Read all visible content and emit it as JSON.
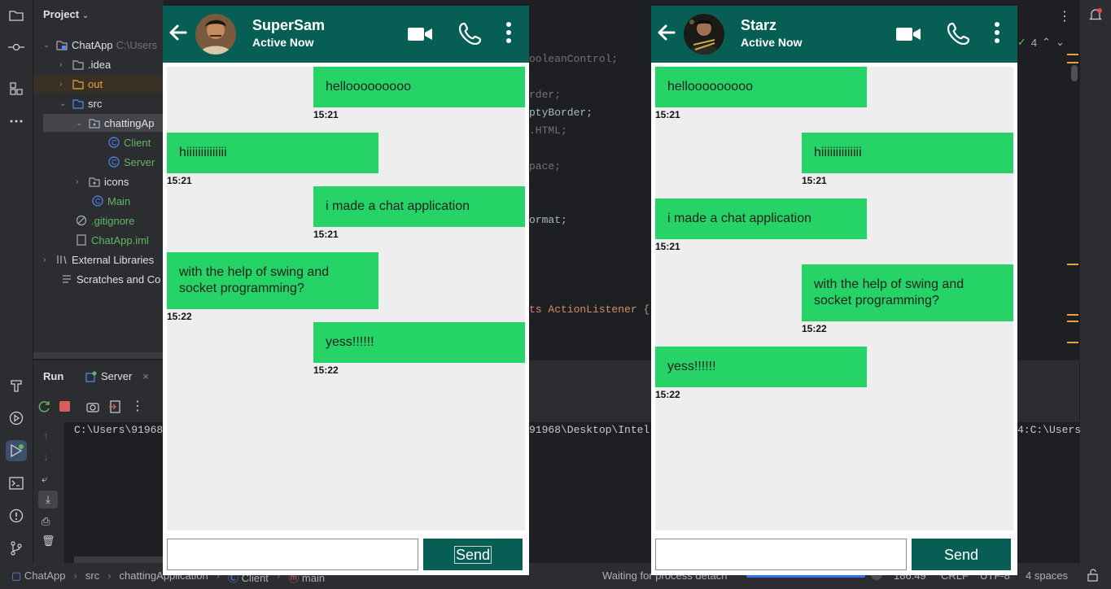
{
  "ide": {
    "project_label": "Project",
    "tree": [
      {
        "label": "ChatApp",
        "suffix": "C:\\Users"
      },
      {
        "label": ".idea"
      },
      {
        "label": "out"
      },
      {
        "label": "src"
      },
      {
        "label": "chattingAp"
      },
      {
        "label": "Client"
      },
      {
        "label": "Server"
      },
      {
        "label": "icons"
      },
      {
        "label": "Main"
      },
      {
        "label": ".gitignore"
      },
      {
        "label": "ChatApp.iml"
      },
      {
        "label": "External Libraries"
      },
      {
        "label": "Scratches and Co"
      }
    ],
    "code_fragments": [
      "ooleanControl;",
      "rder;",
      "ptyBorder;",
      ".HTML;",
      "pace;",
      "ormat;",
      "ts ActionListener {"
    ],
    "problems_count": "4",
    "run": {
      "tab_run": "Run",
      "tab_server": "Server",
      "console_left": "C:\\Users\\91968",
      "console_mid": "91968\\Desktop\\Intel",
      "console_right": "4:C:\\Users"
    },
    "status": {
      "breadcrumb": [
        "ChatApp",
        "src",
        "chattingApplication",
        "Client",
        "main"
      ],
      "process": "Waiting for process detach",
      "position": "186:49",
      "line_sep": "CRLF",
      "encoding": "UTF-8",
      "indent": "4 spaces"
    }
  },
  "chats": [
    {
      "name": "SuperSam",
      "status": "Active Now",
      "messages": [
        {
          "text": "hellooooooooo",
          "time": "15:21",
          "side": "right"
        },
        {
          "text": "hiiiiiiiiiiiiii",
          "time": "15:21",
          "side": "left"
        },
        {
          "text": "i made a chat application",
          "time": "15:21",
          "side": "right"
        },
        {
          "text": "with the help of swing and socket programming?",
          "time": "15:22",
          "side": "left"
        },
        {
          "text": "yess!!!!!!",
          "time": "15:22",
          "side": "right"
        }
      ],
      "input_value": "",
      "send_label": "Send"
    },
    {
      "name": "Starz",
      "status": "Active Now",
      "messages": [
        {
          "text": "hellooooooooo",
          "time": "15:21",
          "side": "left"
        },
        {
          "text": "hiiiiiiiiiiiiii",
          "time": "15:21",
          "side": "right"
        },
        {
          "text": "i made a chat application",
          "time": "15:21",
          "side": "left"
        },
        {
          "text": "with the help of swing and socket programming?",
          "time": "15:22",
          "side": "right"
        },
        {
          "text": "yess!!!!!!",
          "time": "15:22",
          "side": "left"
        }
      ],
      "input_value": "",
      "send_label": "Send"
    }
  ],
  "colors": {
    "chat_header": "#075e54",
    "bubble": "#25d366",
    "chat_bg": "#eeeeee",
    "ide_bg": "#1e1f22",
    "ide_panel": "#2b2d30"
  }
}
